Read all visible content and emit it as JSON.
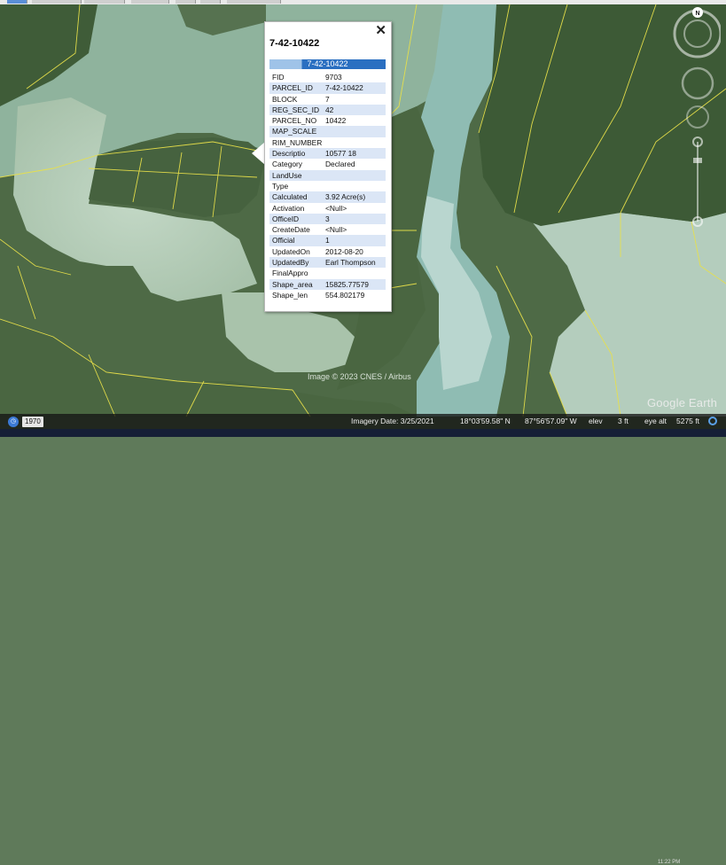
{
  "map": {
    "imagery_credit": "Image © 2023 CNES / Airbus",
    "brand": "Google Earth",
    "compass_letter": "N"
  },
  "popup": {
    "title": "7-42-10422",
    "header": "7-42-10422",
    "close_label": "✕",
    "rows": [
      {
        "key": "FID",
        "value": "9703"
      },
      {
        "key": "PARCEL_ID",
        "value": "7-42-10422"
      },
      {
        "key": "BLOCK",
        "value": "7"
      },
      {
        "key": "REG_SEC_ID",
        "value": "42"
      },
      {
        "key": "PARCEL_NO",
        "value": "10422"
      },
      {
        "key": "MAP_SCALE",
        "value": ""
      },
      {
        "key": "RIM_NUMBER",
        "value": ""
      },
      {
        "key": "Descriptio",
        "value": "10577 18"
      },
      {
        "key": "Category",
        "value": "Declared"
      },
      {
        "key": "LandUse",
        "value": ""
      },
      {
        "key": "Type",
        "value": ""
      },
      {
        "key": "Calculated",
        "value": "3.92 Acre(s)"
      },
      {
        "key": "Activation",
        "value": "<Null>"
      },
      {
        "key": "OfficeID",
        "value": "3"
      },
      {
        "key": "CreateDate",
        "value": "<Null>"
      },
      {
        "key": "Official",
        "value": "1"
      },
      {
        "key": "UpdatedOn",
        "value": "2012-08-20"
      },
      {
        "key": "UpdatedBy",
        "value": "Earl Thompson"
      },
      {
        "key": "FinalAppro",
        "value": ""
      },
      {
        "key": "Shape_area",
        "value": "15825.77579"
      },
      {
        "key": "Shape_len",
        "value": "554.802179"
      }
    ]
  },
  "footer": {
    "year": "1970",
    "imagery_date": "Imagery Date: 3/25/2021",
    "lat": "18°03'59.58\" N",
    "lon": "87°56'57.09\" W",
    "elev_label": "elev",
    "elev_value": "3 ft",
    "eye_alt_label": "eye alt",
    "eye_alt_value": "5275 ft"
  },
  "taskbar": {
    "time": "11:22 PM"
  },
  "colors": {
    "parcel_line": "#e8e04a",
    "popup_header": "#2a6fc1",
    "row_alt": "#dbe6f6"
  }
}
